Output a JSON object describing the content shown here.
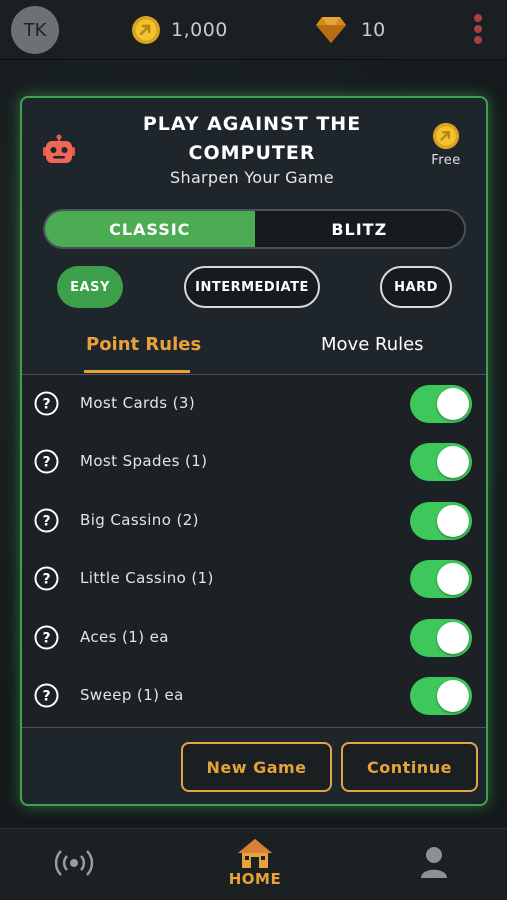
{
  "header": {
    "avatar_initials": "TK",
    "coins": "1,000",
    "gems": "10"
  },
  "modal": {
    "title": "PLAY AGAINST THE COMPUTER",
    "subtitle": "Sharpen Your Game",
    "cost_label": "Free",
    "modes": [
      {
        "label": "CLASSIC",
        "selected": true
      },
      {
        "label": "BLITZ",
        "selected": false
      }
    ],
    "difficulties": [
      {
        "label": "EASY",
        "selected": true
      },
      {
        "label": "INTERMEDIATE",
        "selected": false
      },
      {
        "label": "HARD",
        "selected": false
      }
    ],
    "tabs": [
      {
        "label": "Point Rules",
        "active": true
      },
      {
        "label": "Move Rules",
        "active": false
      }
    ],
    "rules": [
      {
        "label": "Most Cards (3)",
        "enabled": true
      },
      {
        "label": "Most Spades (1)",
        "enabled": true
      },
      {
        "label": "Big Cassino (2)",
        "enabled": true
      },
      {
        "label": "Little Cassino (1)",
        "enabled": true
      },
      {
        "label": "Aces (1) ea",
        "enabled": true
      },
      {
        "label": "Sweep (1) ea",
        "enabled": true
      }
    ],
    "buttons": {
      "new_game": "New Game",
      "continue": "Continue"
    }
  },
  "bottom_nav": {
    "home_label": "HOME",
    "icons": [
      "broadcast-icon",
      "home-icon",
      "profile-icon"
    ]
  },
  "colors": {
    "accent_green": "#4cac54",
    "accent_orange": "#e8a23a",
    "toggle_on": "#3ec75a",
    "modal_border": "#3fa14b"
  }
}
